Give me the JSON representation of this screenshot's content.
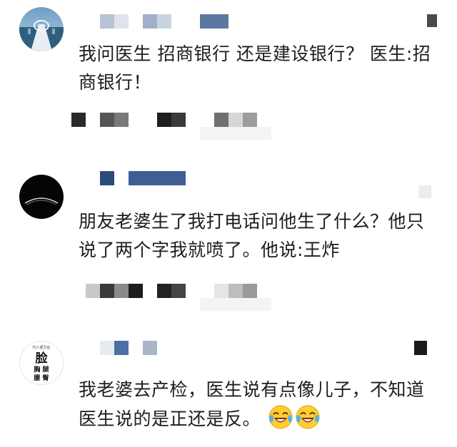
{
  "comments": [
    {
      "avatar_icon": "pier-photo-avatar",
      "text": "我问医生  招商银行  还是建设银行？ 医生:招商银行！",
      "emojis": []
    },
    {
      "avatar_icon": "black-planet-avatar",
      "text": "朋友老婆生了我打电话问他生了什么？他只说了两个字我就喷了。他说:王炸",
      "emojis": []
    },
    {
      "avatar_icon": "face-text-avatar",
      "avatar_label_top": "巧人便力在",
      "avatar_label_main": "脸",
      "avatar_label_row2": "胸 腿",
      "avatar_label_row3": "腰 臀",
      "text": "我老婆去产检，医生说有点像儿子，不知道医生说的是正还是反。",
      "emojis": [
        "crying-laughing-emoji",
        "crying-laughing-emoji"
      ]
    }
  ]
}
